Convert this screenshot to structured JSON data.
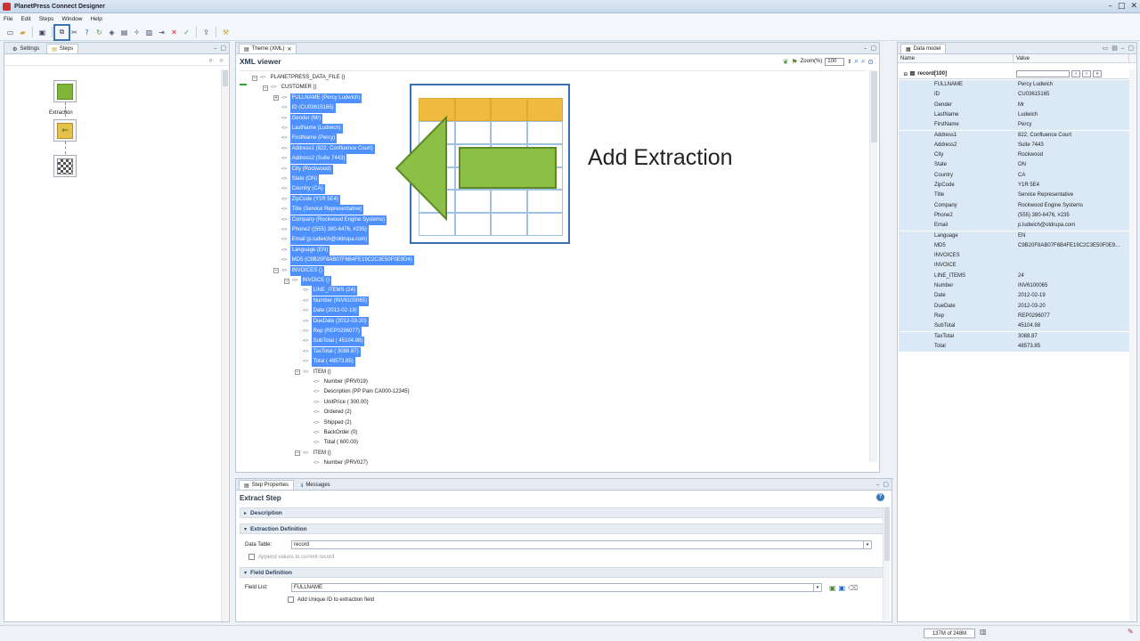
{
  "app": {
    "title": "PlanetPress Connect Designer"
  },
  "menu": [
    "File",
    "Edit",
    "Steps",
    "Window",
    "Help"
  ],
  "left_panel": {
    "tabs": [
      "Settings",
      "Steps"
    ],
    "steps": [
      {
        "label": "",
        "color": "#7fb63a"
      },
      {
        "label": "Extraction",
        "color": "#e6c24a"
      },
      {
        "label": "",
        "color": "#ffffff"
      }
    ]
  },
  "center_panel": {
    "tab": "Theme (XML)",
    "viewer_title": "XML viewer",
    "zoom_label": "Zoom(%)",
    "zoom_value": "100",
    "xml_lines": [
      {
        "text": "PLANETPRESS_DATA_FILE ()",
        "indent": 0,
        "exp": "⊟",
        "hl": false
      },
      {
        "text": "CUSTOMER ()",
        "indent": 1,
        "exp": "⊟",
        "hl": false
      },
      {
        "text": "FULLNAME (Percy Ludwich)",
        "indent": 2,
        "exp": "⊞",
        "hl": true
      },
      {
        "text": "ID (CU03615165)",
        "indent": 2,
        "exp": "",
        "hl": true
      },
      {
        "text": "Gender (Mr)",
        "indent": 2,
        "exp": "",
        "hl": true
      },
      {
        "text": "LastName (Ludwich)",
        "indent": 2,
        "exp": "",
        "hl": true
      },
      {
        "text": "FirstName (Percy)",
        "indent": 2,
        "exp": "",
        "hl": true
      },
      {
        "text": "Address1 (822, Confluence Court)",
        "indent": 2,
        "exp": "",
        "hl": true
      },
      {
        "text": "Address2 (Suite 7443)",
        "indent": 2,
        "exp": "",
        "hl": true
      },
      {
        "text": "City (Rockwood)",
        "indent": 2,
        "exp": "",
        "hl": true
      },
      {
        "text": "State (ON)",
        "indent": 2,
        "exp": "",
        "hl": true
      },
      {
        "text": "Country (CA)",
        "indent": 2,
        "exp": "",
        "hl": true
      },
      {
        "text": "ZipCode (Y1R 5E4)",
        "indent": 2,
        "exp": "",
        "hl": true
      },
      {
        "text": "Title (Service Representative)",
        "indent": 2,
        "exp": "",
        "hl": true
      },
      {
        "text": "Company (Rockwood Engine Systems)",
        "indent": 2,
        "exp": "",
        "hl": true
      },
      {
        "text": "Phone2 ((555) 380-6476, #235)",
        "indent": 2,
        "exp": "",
        "hl": true
      },
      {
        "text": "Email (p.ludwich@oldrupa.com)",
        "indent": 2,
        "exp": "",
        "hl": true
      },
      {
        "text": "Language (EN)",
        "indent": 2,
        "exp": "",
        "hl": true
      },
      {
        "text": "MD5 (C9B20F8AB07F6B4FE19C2C3E50F0E9D4)",
        "indent": 2,
        "exp": "",
        "hl": true
      },
      {
        "text": "INVOICES ()",
        "indent": 2,
        "exp": "⊟",
        "hl": true
      },
      {
        "text": "INVOICE ()",
        "indent": 3,
        "exp": "⊟",
        "hl": true
      },
      {
        "text": "LINE_ITEMS (24)",
        "indent": 4,
        "exp": "",
        "hl": true
      },
      {
        "text": "Number (INV6100065)",
        "indent": 4,
        "exp": "",
        "hl": true
      },
      {
        "text": "Date (2012-02-19)",
        "indent": 4,
        "exp": "",
        "hl": true
      },
      {
        "text": "DueDate (2012-03-20)",
        "indent": 4,
        "exp": "",
        "hl": true
      },
      {
        "text": "Rep (REP0296077)",
        "indent": 4,
        "exp": "",
        "hl": true
      },
      {
        "text": "SubTotal ( 45104.98)",
        "indent": 4,
        "exp": "",
        "hl": true
      },
      {
        "text": "TaxTotal ( 3088.87)",
        "indent": 4,
        "exp": "",
        "hl": true
      },
      {
        "text": "Total ( 48573.85)",
        "indent": 4,
        "exp": "",
        "hl": true
      },
      {
        "text": "ITEM ()",
        "indent": 4,
        "exp": "⊟",
        "hl": false
      },
      {
        "text": "Number (PRV019)",
        "indent": 5,
        "exp": "",
        "hl": false
      },
      {
        "text": "Description (PP Pain CA000-12345)",
        "indent": 5,
        "exp": "",
        "hl": false
      },
      {
        "text": "UnitPrice (   300.00)",
        "indent": 5,
        "exp": "",
        "hl": false
      },
      {
        "text": "Ordered (2)",
        "indent": 5,
        "exp": "",
        "hl": false
      },
      {
        "text": "Shipped (2)",
        "indent": 5,
        "exp": "",
        "hl": false
      },
      {
        "text": "BackOrder (0)",
        "indent": 5,
        "exp": "",
        "hl": false
      },
      {
        "text": "Total (   600.00)",
        "indent": 5,
        "exp": "",
        "hl": false
      },
      {
        "text": "ITEM ()",
        "indent": 4,
        "exp": "⊟",
        "hl": false
      },
      {
        "text": "Number (PRV027)",
        "indent": 5,
        "exp": "",
        "hl": false
      }
    ]
  },
  "overlay": {
    "label": "Add Extraction",
    "accent": "#8bbf45",
    "header_color": "#f0b940"
  },
  "props_panel": {
    "tabs": [
      "Step Properties",
      "Messages"
    ],
    "title": "Extract Step",
    "sections": {
      "description": "Description",
      "extraction_definition": "Extraction Definition",
      "field_definition": "Field Definition"
    },
    "data_table_label": "Data Table:",
    "data_table_value": "record",
    "append_label": "Append values to current record",
    "field_list_label": "Field List:",
    "field_list_value": "FULLNAME",
    "unique_id_label": "Add Unique ID to extraction field"
  },
  "data_model": {
    "tab": "Data model",
    "col_name": "Name",
    "col_value": "Value",
    "record_label": "record[100]",
    "rows": [
      {
        "name": "FULLNAME",
        "value": "Percy Ludwich"
      },
      {
        "name": "ID",
        "value": "CU03615165"
      },
      {
        "name": "Gender",
        "value": "Mr"
      },
      {
        "name": "LastName",
        "value": "Ludwich"
      },
      {
        "name": "FirstName",
        "value": "Percy"
      },
      {
        "name": "Address1",
        "value": "822, Confluence Court"
      },
      {
        "name": "Address2",
        "value": "Suite 7443"
      },
      {
        "name": "City",
        "value": "Rockwood"
      },
      {
        "name": "State",
        "value": "ON"
      },
      {
        "name": "Country",
        "value": "CA"
      },
      {
        "name": "ZipCode",
        "value": "Y1R 5E4"
      },
      {
        "name": "Title",
        "value": "Service Representative"
      },
      {
        "name": "Company",
        "value": "Rockwood Engine Systems"
      },
      {
        "name": "Phone2",
        "value": "(555) 380-6476, #235"
      },
      {
        "name": "Email",
        "value": "p.ludwich@oldrupa.com"
      },
      {
        "name": "Language",
        "value": "EN"
      },
      {
        "name": "MD5",
        "value": "C9B20F8AB07F6B4FE19C2C3E50F0E9..."
      },
      {
        "name": "INVOICES",
        "value": ""
      },
      {
        "name": "INVOICE",
        "value": ""
      },
      {
        "name": "LINE_ITEMS",
        "value": "24"
      },
      {
        "name": "Number",
        "value": "INV6100065"
      },
      {
        "name": "Date",
        "value": "2012-02-19"
      },
      {
        "name": "DueDate",
        "value": "2012-03-20"
      },
      {
        "name": "Rep",
        "value": "REP0296077"
      },
      {
        "name": "SubTotal",
        "value": "45104.98"
      },
      {
        "name": "TaxTotal",
        "value": "3088.87"
      },
      {
        "name": "Total",
        "value": "48573.85"
      }
    ]
  },
  "status": {
    "memory": "137M of 248M"
  }
}
